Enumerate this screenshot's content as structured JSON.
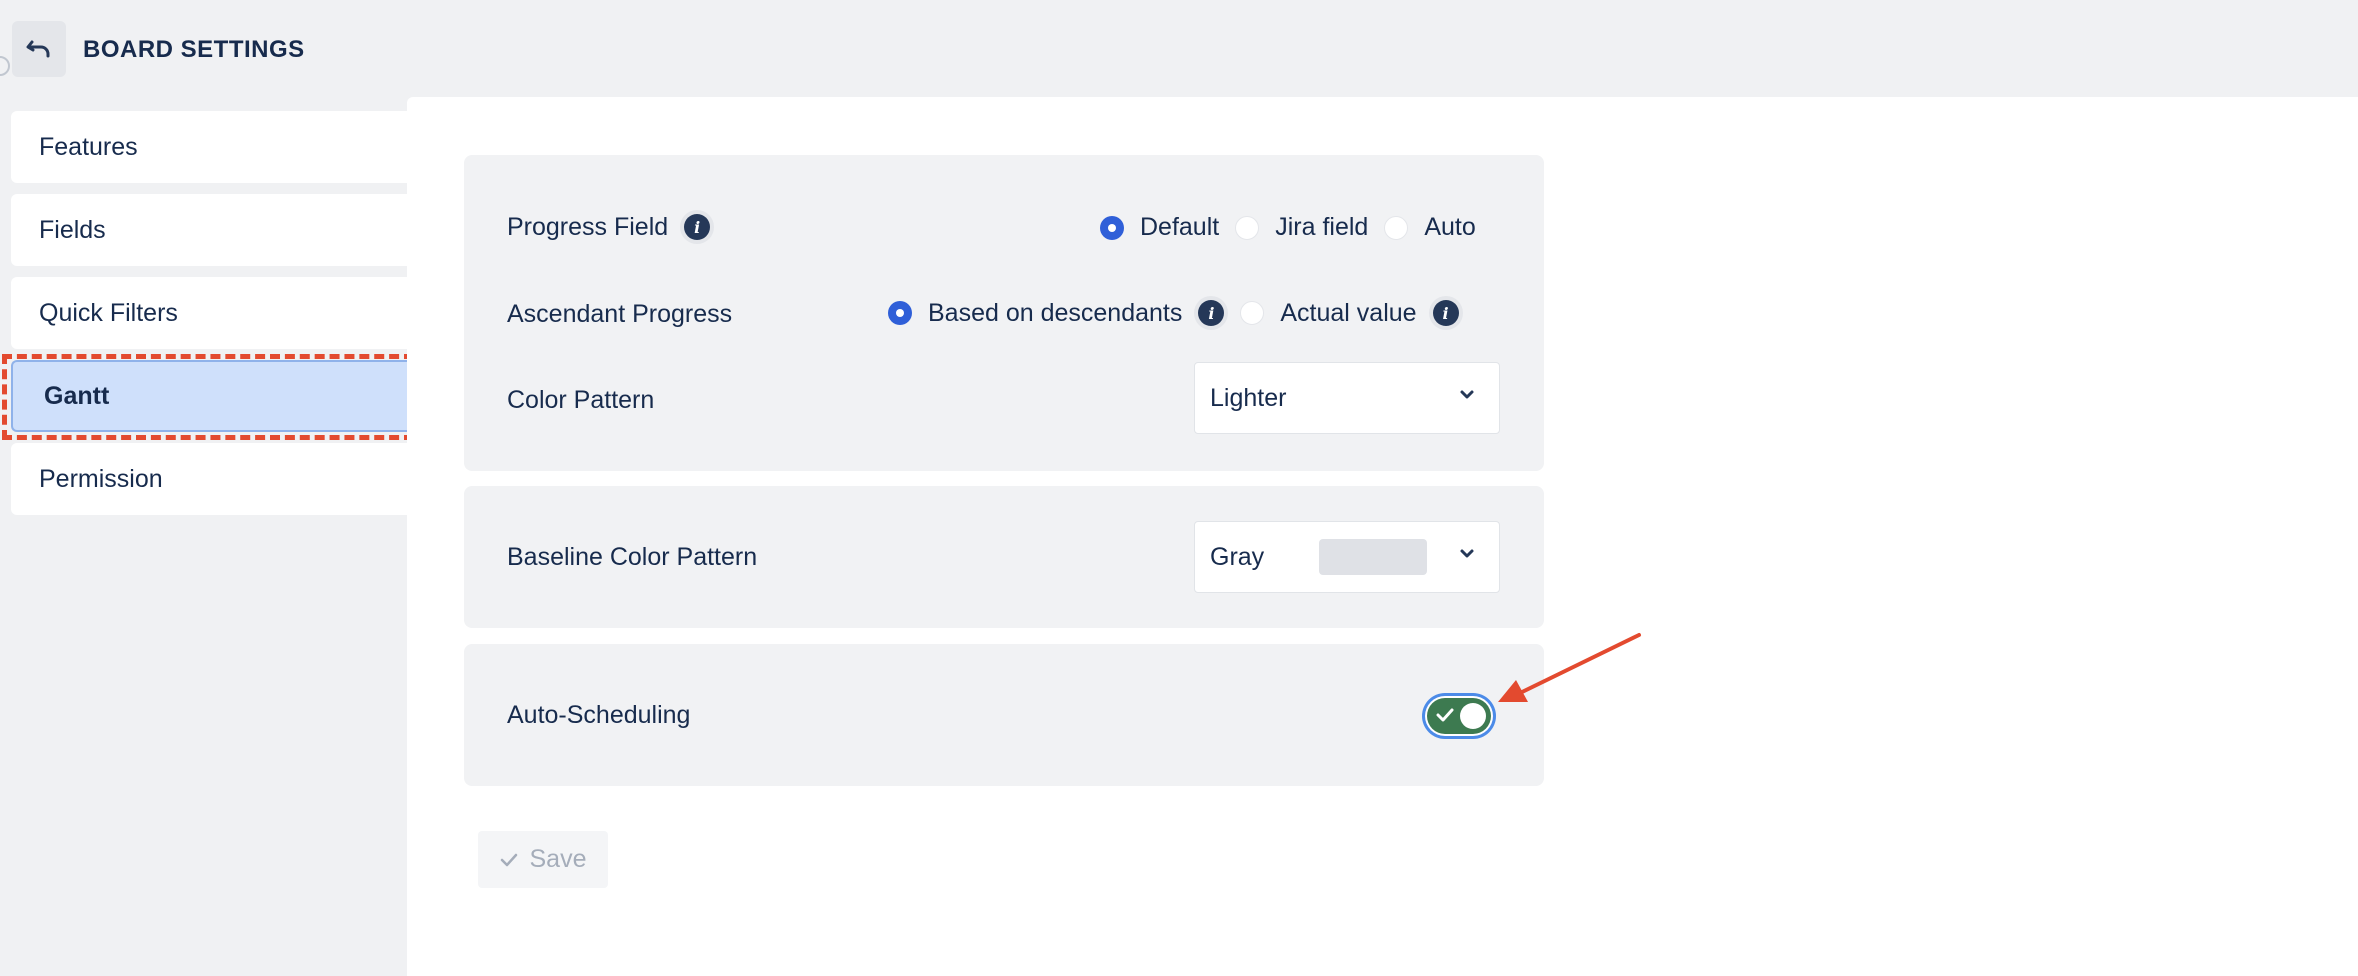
{
  "header": {
    "title": "BOARD SETTINGS",
    "back_icon": "undo-icon"
  },
  "sidebar": {
    "items": [
      {
        "label": "Features",
        "active": false
      },
      {
        "label": "Fields",
        "active": false
      },
      {
        "label": "Quick Filters",
        "active": false
      },
      {
        "label": "Gantt",
        "active": true
      },
      {
        "label": "Permission",
        "active": false
      }
    ]
  },
  "gantt": {
    "progress_field": {
      "label": "Progress Field",
      "options": [
        "Default",
        "Jira field",
        "Auto"
      ],
      "selected": "Default"
    },
    "ascendant_progress": {
      "label": "Ascendant Progress",
      "options": [
        "Based on descendants",
        "Actual value"
      ],
      "selected": "Based on descendants"
    },
    "color_pattern": {
      "label": "Color Pattern",
      "value": "Lighter"
    },
    "baseline_color_pattern": {
      "label": "Baseline Color Pattern",
      "value": "Gray",
      "swatch_color": "#dfe1e6"
    },
    "auto_scheduling": {
      "label": "Auto-Scheduling",
      "enabled": true
    },
    "save_label": "Save"
  },
  "colors": {
    "accent": "#2f5fd8",
    "toggle_on": "#3d7a50",
    "annotation": "#e34a2f",
    "active_nav": "#cfe0fb"
  }
}
